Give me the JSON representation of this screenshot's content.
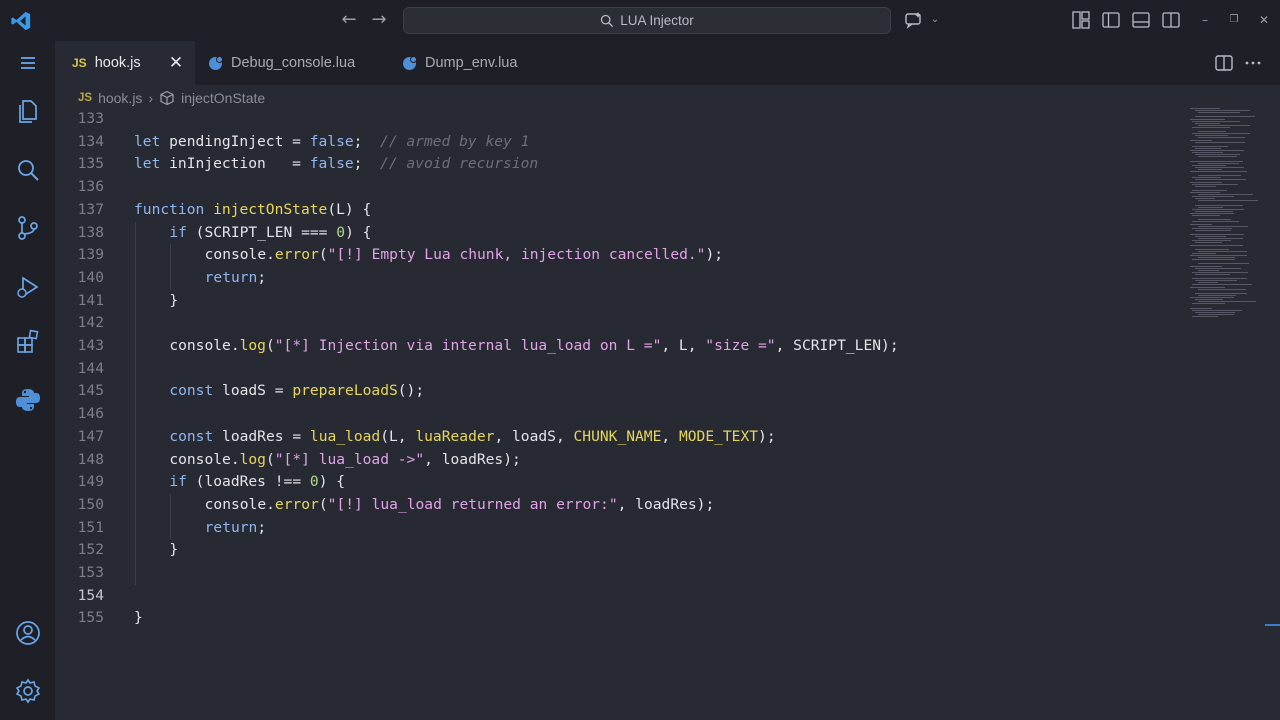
{
  "titlebar": {
    "search_text": "LUA Injector",
    "icons": [
      "vscode-logo-icon",
      "back-arrow-icon",
      "forward-arrow-icon",
      "search-icon",
      "copilot-icon",
      "layout-icons"
    ]
  },
  "activity_bar": {
    "items": [
      "menu-icon",
      "explorer-icon",
      "search-icon",
      "source-control-icon",
      "run-debug-icon",
      "extensions-icon",
      "python-icon",
      "account-icon",
      "settings-gear-icon"
    ]
  },
  "tabs": [
    {
      "label": "hook.js",
      "badge": "JS",
      "active": true
    },
    {
      "label": "Debug_console.lua",
      "badge": "",
      "active": false
    },
    {
      "label": "Dump_env.lua",
      "badge": "",
      "active": false
    }
  ],
  "breadcrumb": {
    "file_badge": "JS",
    "file": "hook.js",
    "symbol": "injectOnState"
  },
  "editor": {
    "current_line": "154",
    "lines": [
      {
        "n": "133",
        "indent": 0,
        "tokens": []
      },
      {
        "n": "134",
        "indent": 0,
        "tokens": [
          [
            "kw",
            "let"
          ],
          [
            "t",
            " pendingInject = "
          ],
          [
            "kw",
            "false"
          ],
          [
            "t",
            ";  "
          ],
          [
            "cm",
            "// armed by key 1"
          ]
        ]
      },
      {
        "n": "135",
        "indent": 0,
        "tokens": [
          [
            "kw",
            "let"
          ],
          [
            "t",
            " inInjection   = "
          ],
          [
            "kw",
            "false"
          ],
          [
            "t",
            ";  "
          ],
          [
            "cm",
            "// avoid recursion"
          ]
        ]
      },
      {
        "n": "136",
        "indent": 0,
        "tokens": []
      },
      {
        "n": "137",
        "indent": 0,
        "tokens": [
          [
            "kw",
            "function"
          ],
          [
            "t",
            " "
          ],
          [
            "fn",
            "injectOnState"
          ],
          [
            "t",
            "(L) {"
          ]
        ]
      },
      {
        "n": "138",
        "indent": 1,
        "tokens": [
          [
            "kw",
            "if"
          ],
          [
            "t",
            " (SCRIPT_LEN === "
          ],
          [
            "num",
            "0"
          ],
          [
            "t",
            ") {"
          ]
        ]
      },
      {
        "n": "139",
        "indent": 2,
        "tokens": [
          [
            "t",
            "console."
          ],
          [
            "fn",
            "error"
          ],
          [
            "t",
            "("
          ],
          [
            "str",
            "\"[!] Empty Lua chunk, injection cancelled.\""
          ],
          [
            "t",
            ");"
          ]
        ]
      },
      {
        "n": "140",
        "indent": 2,
        "tokens": [
          [
            "kw",
            "return"
          ],
          [
            "t",
            ";"
          ]
        ]
      },
      {
        "n": "141",
        "indent": 1,
        "tokens": [
          [
            "t",
            "}"
          ]
        ]
      },
      {
        "n": "142",
        "indent": 0,
        "tokens": []
      },
      {
        "n": "143",
        "indent": 1,
        "tokens": [
          [
            "t",
            "console."
          ],
          [
            "fn",
            "log"
          ],
          [
            "t",
            "("
          ],
          [
            "str",
            "\"[*] Injection via internal lua_load on L =\""
          ],
          [
            "t",
            ", L, "
          ],
          [
            "str",
            "\"size =\""
          ],
          [
            "t",
            ", SCRIPT_LEN);"
          ]
        ]
      },
      {
        "n": "144",
        "indent": 0,
        "tokens": []
      },
      {
        "n": "145",
        "indent": 1,
        "tokens": [
          [
            "kw",
            "const"
          ],
          [
            "t",
            " loadS = "
          ],
          [
            "fn",
            "prepareLoadS"
          ],
          [
            "t",
            "();"
          ]
        ]
      },
      {
        "n": "146",
        "indent": 0,
        "tokens": []
      },
      {
        "n": "147",
        "indent": 1,
        "tokens": [
          [
            "kw",
            "const"
          ],
          [
            "t",
            " loadRes = "
          ],
          [
            "fn",
            "lua_load"
          ],
          [
            "t",
            "(L, "
          ],
          [
            "fn",
            "luaReader"
          ],
          [
            "t",
            ", loadS, "
          ],
          [
            "fn",
            "CHUNK_NAME"
          ],
          [
            "t",
            ", "
          ],
          [
            "fn",
            "MODE_TEXT"
          ],
          [
            "t",
            ");"
          ]
        ]
      },
      {
        "n": "148",
        "indent": 1,
        "tokens": [
          [
            "t",
            "console."
          ],
          [
            "fn",
            "log"
          ],
          [
            "t",
            "("
          ],
          [
            "str",
            "\"[*] lua_load ->\""
          ],
          [
            "t",
            ", loadRes);"
          ]
        ]
      },
      {
        "n": "149",
        "indent": 1,
        "tokens": [
          [
            "kw",
            "if"
          ],
          [
            "t",
            " (loadRes !== "
          ],
          [
            "num",
            "0"
          ],
          [
            "t",
            ") {"
          ]
        ]
      },
      {
        "n": "150",
        "indent": 2,
        "tokens": [
          [
            "t",
            "console."
          ],
          [
            "fn",
            "error"
          ],
          [
            "t",
            "("
          ],
          [
            "str",
            "\"[!] lua_load returned an error:\""
          ],
          [
            "t",
            ", loadRes);"
          ]
        ]
      },
      {
        "n": "151",
        "indent": 2,
        "tokens": [
          [
            "kw",
            "return"
          ],
          [
            "t",
            ";"
          ]
        ]
      },
      {
        "n": "152",
        "indent": 1,
        "tokens": [
          [
            "t",
            "}"
          ]
        ]
      },
      {
        "n": "153",
        "indent": 0,
        "tokens": []
      },
      {
        "n": "154",
        "indent": 0,
        "tokens": []
      },
      {
        "n": "155",
        "indent": 0,
        "tokens": [
          [
            "t",
            "}"
          ]
        ]
      }
    ]
  },
  "colors": {
    "bg": "#282a33",
    "chrome": "#1f2027",
    "keyword": "#8fb6ef",
    "function": "#e6d65c",
    "string": "#e2a2e8",
    "number": "#b7d68f",
    "comment": "#6b6f7a"
  }
}
